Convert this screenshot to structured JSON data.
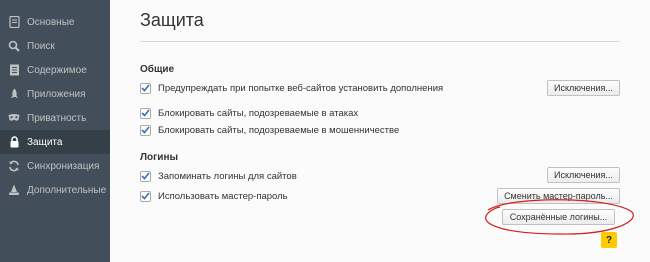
{
  "sidebar": {
    "items": [
      {
        "label": "Основные",
        "icon": "page-icon"
      },
      {
        "label": "Поиск",
        "icon": "search-icon"
      },
      {
        "label": "Содержимое",
        "icon": "document-icon"
      },
      {
        "label": "Приложения",
        "icon": "rocket-icon"
      },
      {
        "label": "Приватность",
        "icon": "mask-icon"
      },
      {
        "label": "Защита",
        "icon": "lock-icon"
      },
      {
        "label": "Синхронизация",
        "icon": "sync-icon"
      },
      {
        "label": "Дополнительные",
        "icon": "wizard-hat-icon"
      }
    ],
    "active_index": 5
  },
  "main": {
    "title": "Защита",
    "general": {
      "heading": "Общие",
      "warn_addons": "Предупреждать при попытке веб-сайтов установить дополнения",
      "block_attack": "Блокировать сайты, подозреваемые в атаках",
      "block_fraud": "Блокировать сайты, подозреваемые в мошенничестве",
      "exceptions_button": "Исключения..."
    },
    "logins": {
      "heading": "Логины",
      "remember": "Запоминать логины для сайтов",
      "master_password": "Использовать мастер-пароль",
      "exceptions_button": "Исключения...",
      "change_master_button": "Сменить мастер-пароль...",
      "saved_logins_button": "Сохранённые логины..."
    },
    "help_glyph": "?"
  },
  "colors": {
    "sidebar_bg": "#424f5a",
    "sidebar_active": "#343f48",
    "help_bg": "#ffcb00",
    "annotation": "#d02020"
  }
}
